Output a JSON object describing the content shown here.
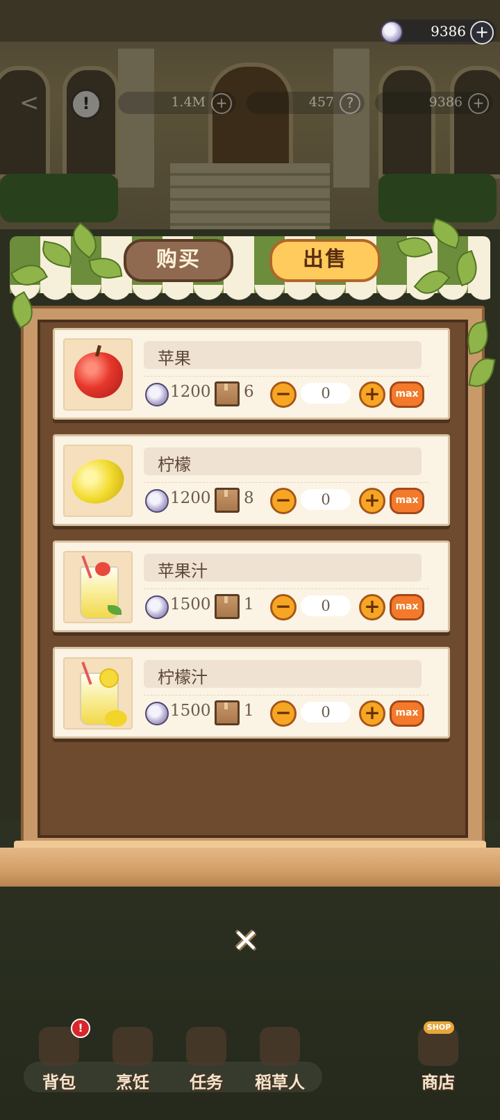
{
  "top_currency": {
    "value": "9386",
    "icon": "silver-coin-icon",
    "plus": "+"
  },
  "hud": {
    "back_icon": "back-arrow-icon",
    "alert": "!",
    "gold": {
      "value": "1.4M",
      "action": "+"
    },
    "gem": {
      "value": "457",
      "action": "?"
    },
    "silver": {
      "value": "9386",
      "action": "+"
    }
  },
  "tabs": {
    "buy": "购买",
    "sell": "出售",
    "active": "sell"
  },
  "items": [
    {
      "name": "苹果",
      "price": "1200",
      "stock": "6",
      "qty": "0",
      "icon": "apple-icon"
    },
    {
      "name": "柠檬",
      "price": "1200",
      "stock": "8",
      "qty": "0",
      "icon": "lemon-icon"
    },
    {
      "name": "苹果汁",
      "price": "1500",
      "stock": "1",
      "qty": "0",
      "icon": "apple-juice-icon"
    },
    {
      "name": "柠檬汁",
      "price": "1500",
      "stock": "1",
      "qty": "0",
      "icon": "lemonade-icon"
    }
  ],
  "controls": {
    "minus": "−",
    "plus": "+",
    "max": "max"
  },
  "close": "✕",
  "nav": {
    "backpack": "背包",
    "backpack_badge": "!",
    "cooking": "烹饪",
    "tasks": "任务",
    "scarecrow": "稻草人",
    "shop": "商店",
    "shop_tag": "SHOP"
  },
  "colors": {
    "board": "#6e4a2e",
    "card": "#fbf3e4",
    "accent_orange": "#f7a623",
    "max_button": "#f37a2a",
    "sell_tab": "#ffcb5c",
    "buy_tab": "#8f6a50"
  }
}
